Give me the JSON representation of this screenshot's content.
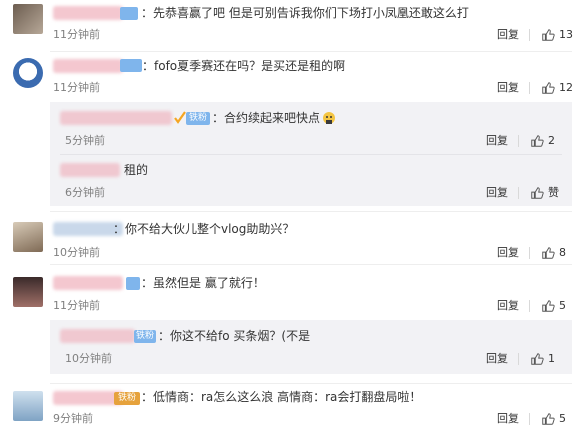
{
  "comments": [
    {
      "text": "：先恭喜赢了吧 但是可别告诉我你们下场打小凤凰还敢这么打",
      "time": "11分钟前",
      "reply": "回复",
      "likes": "13",
      "avatar_color": "#8a7a6a"
    },
    {
      "text": "：fofo夏季赛还在吗？是买还是租的啊",
      "time": "11分钟前",
      "reply": "回复",
      "likes": "12",
      "avatar_color": "#3b6bb0",
      "subreplies": [
        {
          "badge": "铁粉",
          "text": "：合约续起来吧快点",
          "time": "5分钟前",
          "reply": "回复",
          "likes": "2"
        },
        {
          "text": "租的",
          "time": "6分钟前",
          "reply": "回复",
          "likes": "赞"
        }
      ]
    },
    {
      "text": "：你不给大伙儿整个vlog助助兴？",
      "time": "10分钟前",
      "reply": "回复",
      "likes": "8",
      "avatar_color": "#9c8870"
    },
    {
      "text": "：虽然但是 赢了就行！",
      "time": "11分钟前",
      "reply": "回复",
      "likes": "5",
      "avatar_color": "#6b4c48",
      "subreplies": [
        {
          "badge": "铁粉",
          "text": "：你这不给fo 买条烟？(不是",
          "time": "10分钟前",
          "reply": "回复",
          "likes": "1"
        }
      ]
    },
    {
      "badge": "铁粉",
      "text": "：低情商：ra怎么这么浪 高情商：ra会打翻盘局啦！",
      "time": "9分钟前",
      "reply": "回复",
      "likes": "5",
      "avatar_color": "#a9c3da"
    }
  ],
  "colors": {
    "badge_blue": "#7fb5ec",
    "badge_gold": "#e6a23c",
    "sub_bg": "#f2f2f5",
    "time": "#808080"
  },
  "icons": {
    "like": "thumbs-up-icon",
    "verified": "verified-check-icon",
    "emoji": "face-emoji-icon"
  }
}
